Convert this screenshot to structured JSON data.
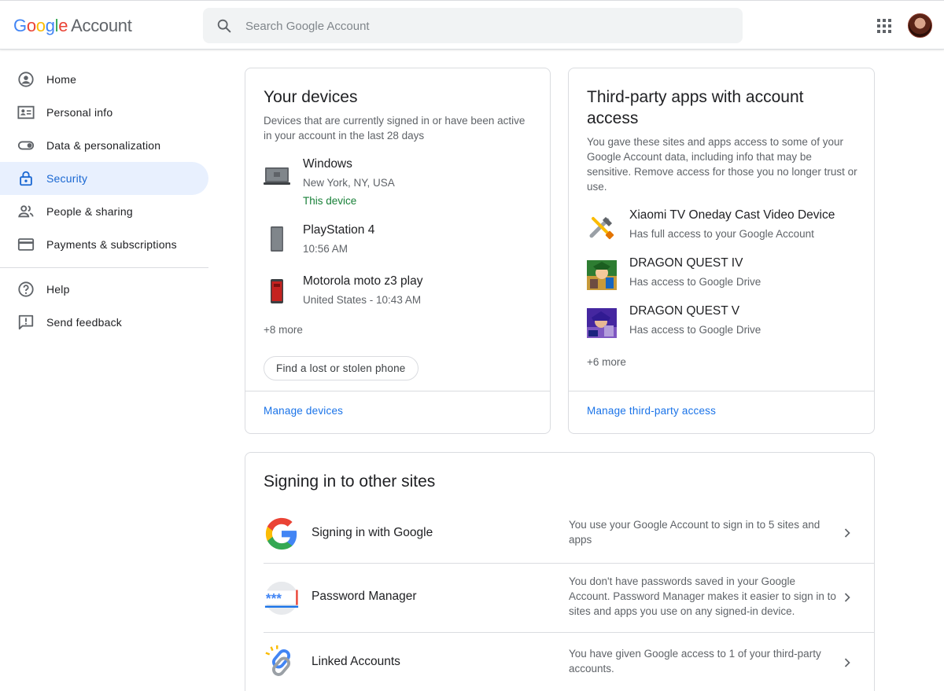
{
  "header": {
    "logo_google": [
      "G",
      "o",
      "o",
      "g",
      "l",
      "e"
    ],
    "logo_account": "Account",
    "search_placeholder": "Search Google Account",
    "icons": {
      "search": "search-icon",
      "apps": "apps-grid-icon",
      "avatar": "account-avatar"
    }
  },
  "sidebar": {
    "items": [
      {
        "label": "Home",
        "icon": "home-icon",
        "active": false
      },
      {
        "label": "Personal info",
        "icon": "personal-info-icon",
        "active": false
      },
      {
        "label": "Data & personalization",
        "icon": "toggle-icon",
        "active": false
      },
      {
        "label": "Security",
        "icon": "lock-icon",
        "active": true
      },
      {
        "label": "People & sharing",
        "icon": "people-icon",
        "active": false
      },
      {
        "label": "Payments & subscriptions",
        "icon": "credit-card-icon",
        "active": false
      }
    ],
    "secondary": [
      {
        "label": "Help",
        "icon": "help-icon"
      },
      {
        "label": "Send feedback",
        "icon": "feedback-icon"
      }
    ]
  },
  "devices_card": {
    "title": "Your devices",
    "description": "Devices that are currently signed in or have been active in your account in the last 28 days",
    "devices": [
      {
        "name": "Windows",
        "location": "New York, NY, USA",
        "status": "This device",
        "icon": "laptop-icon"
      },
      {
        "name": "PlayStation 4",
        "location": "10:56 AM",
        "icon": "phone-icon"
      },
      {
        "name": "Motorola moto z3 play",
        "location": "United States - 10:43 AM",
        "icon": "phone-red-icon"
      }
    ],
    "more": "+8 more",
    "find_phone_label": "Find a lost or stolen phone",
    "footer_link": "Manage devices"
  },
  "apps_card": {
    "title": "Third-party apps with account access",
    "description": "You gave these sites and apps access to some of your Google Account data, including info that may be sensitive. Remove access for those you no longer trust or use.",
    "apps": [
      {
        "name": "Xiaomi TV Oneday Cast Video Device",
        "access": "Has full access to your Google Account",
        "icon": "tools-icon"
      },
      {
        "name": "DRAGON QUEST IV",
        "access": "Has access to Google Drive",
        "icon": "dq4-app-icon"
      },
      {
        "name": "DRAGON QUEST V",
        "access": "Has access to Google Drive",
        "icon": "dq5-app-icon"
      }
    ],
    "more": "+6 more",
    "footer_link": "Manage third-party access"
  },
  "signin_card": {
    "title": "Signing in to other sites",
    "rows": [
      {
        "label": "Signing in with Google",
        "description": "You use your Google Account to sign in to 5 sites and apps",
        "icon": "google-g-icon"
      },
      {
        "label": "Password Manager",
        "description": "You don't have passwords saved in your Google Account. Password Manager makes it easier to sign in to sites and apps you use on any signed-in device.",
        "icon": "password-manager-icon"
      },
      {
        "label": "Linked Accounts",
        "description": "You have given Google access to 1 of your third-party accounts.",
        "icon": "link-icon"
      }
    ]
  },
  "colors": {
    "accent": "#1a73e8",
    "active_bg": "#e8f0fe",
    "active_text": "#1967d2",
    "green": "#188038",
    "border": "#dadce0"
  }
}
